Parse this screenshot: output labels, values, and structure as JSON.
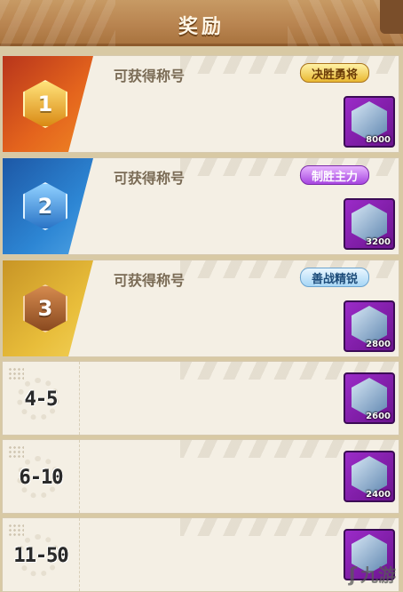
{
  "header": {
    "title": "奖励"
  },
  "rows": [
    {
      "rank": "1",
      "label": "可获得称号",
      "title_badge": "决胜勇将",
      "reward_qty": "8000"
    },
    {
      "rank": "2",
      "label": "可获得称号",
      "title_badge": "制胜主力",
      "reward_qty": "3200"
    },
    {
      "rank": "3",
      "label": "可获得称号",
      "title_badge": "善战精锐",
      "reward_qty": "2800"
    },
    {
      "rank": "4-5",
      "reward_qty": "2600"
    },
    {
      "rank": "6-10",
      "reward_qty": "2400"
    },
    {
      "rank": "11-50",
      "reward_qty": ""
    }
  ],
  "watermark": {
    "text": "九游"
  },
  "colors": {
    "rank1": "#e4641d",
    "rank2": "#2d86d4",
    "rank3": "#e8bd3a",
    "item_bg": "#8a22b8"
  }
}
